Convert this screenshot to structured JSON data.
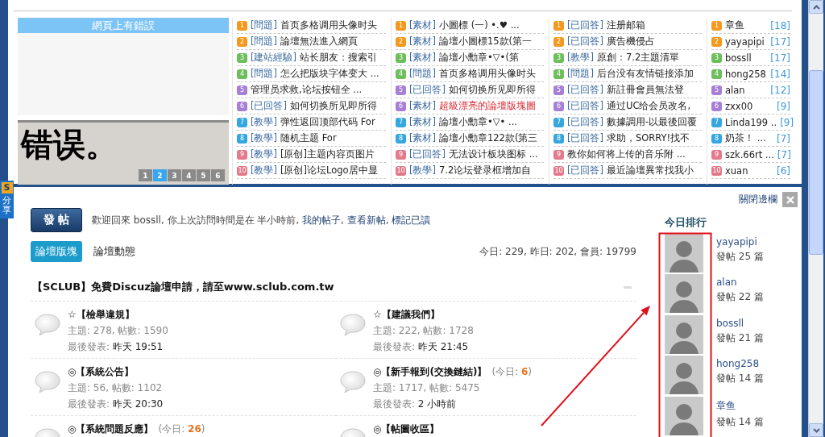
{
  "share": {
    "logo": "S",
    "label": "分享"
  },
  "hot": {
    "slideshow": {
      "title": "網頁上有錯誤",
      "caption": "错误。",
      "pages": [
        {
          "label": "1",
          "selected": false
        },
        {
          "label": "2",
          "selected": true
        },
        {
          "label": "3",
          "selected": false
        },
        {
          "label": "4",
          "selected": false
        },
        {
          "label": "5",
          "selected": false
        },
        {
          "label": "6",
          "selected": false
        }
      ]
    },
    "columns": [
      {
        "items": [
          {
            "rank": "1",
            "color": "#f39a1e",
            "tag": "[問題]",
            "title": "首页多格调用头像时头",
            "hot": false
          },
          {
            "rank": "2",
            "color": "#f39a1e",
            "tag": "[問題]",
            "title": "論壇無法進入網頁",
            "hot": false
          },
          {
            "rank": "3",
            "color": "#6cbf5a",
            "tag": "[建站經驗]",
            "title": "站长朋友：搜索引",
            "hot": false
          },
          {
            "rank": "4",
            "color": "#6cbf5a",
            "tag": "[問題]",
            "title": "怎么把版块字体变大 ...",
            "hot": false
          },
          {
            "rank": "5",
            "color": "#a67fd6",
            "title": "管理员求救,论坛按钮全 ...",
            "hot": false
          },
          {
            "rank": "6",
            "color": "#a67fd6",
            "tag": "[已回答]",
            "title": "如何切换所见即所得",
            "hot": false
          },
          {
            "rank": "7",
            "color": "#35a7de",
            "tag": "[教學]",
            "title": "弹性返回顶部代码 For",
            "hot": false
          },
          {
            "rank": "8",
            "color": "#35a7de",
            "tag": "[教學]",
            "title": "随机主题 For",
            "hot": false
          },
          {
            "rank": "9",
            "color": "#e37a8a",
            "tag": "[教學]",
            "title": "[原创]主题内容页图片",
            "hot": false
          },
          {
            "rank": "10",
            "color": "#e37a8a",
            "tag": "[教學]",
            "title": "[原创]论坛Logo居中显",
            "hot": false
          }
        ]
      },
      {
        "items": [
          {
            "rank": "1",
            "color": "#f39a1e",
            "tag": "[素材]",
            "title": "小圖標 (一) •.♥ ...",
            "hot": false
          },
          {
            "rank": "2",
            "color": "#f39a1e",
            "tag": "[素材]",
            "title": "論壇小圖標15款(第一",
            "hot": false
          },
          {
            "rank": "3",
            "color": "#6cbf5a",
            "tag": "[素材]",
            "title": "論壇小勳章•▽•(第",
            "hot": false
          },
          {
            "rank": "4",
            "color": "#6cbf5a",
            "tag": "[問題]",
            "title": "首页多格调用头像时头",
            "hot": false
          },
          {
            "rank": "5",
            "color": "#a67fd6",
            "tag": "[已回答]",
            "title": "如何切换所见即所得",
            "hot": false
          },
          {
            "rank": "6",
            "color": "#a67fd6",
            "tag": "[素材]",
            "title": "超級漂亮的論壇版塊圖",
            "hot": true
          },
          {
            "rank": "7",
            "color": "#35a7de",
            "tag": "[素材]",
            "title": "論壇小勳章•▽• ...",
            "hot": false
          },
          {
            "rank": "8",
            "color": "#35a7de",
            "tag": "[素材]",
            "title": "論壇小勳章122款(第三",
            "hot": false
          },
          {
            "rank": "9",
            "color": "#e37a8a",
            "tag": "[已回答]",
            "title": "无法设计板块图标 ...",
            "hot": false
          },
          {
            "rank": "10",
            "color": "#e37a8a",
            "tag": "[教學]",
            "title": "7.2论坛登录框增加自",
            "hot": false
          }
        ]
      },
      {
        "items": [
          {
            "rank": "1",
            "color": "#f39a1e",
            "tag": "[已回答]",
            "title": "注册邮箱",
            "hot": false
          },
          {
            "rank": "2",
            "color": "#f39a1e",
            "tag": "[已回答]",
            "title": "廣告機侵占",
            "hot": false
          },
          {
            "rank": "3",
            "color": "#6cbf5a",
            "tag": "[教學]",
            "title": "原創：7.2主題清單",
            "hot": false
          },
          {
            "rank": "4",
            "color": "#6cbf5a",
            "tag": "[問題]",
            "title": "后台没有友情链接添加",
            "hot": false
          },
          {
            "rank": "5",
            "color": "#a67fd6",
            "tag": "[已回答]",
            "title": "新註冊會員無法登",
            "hot": false
          },
          {
            "rank": "6",
            "color": "#a67fd6",
            "tag": "[已回答]",
            "title": "通过UC给会员改名,",
            "hot": false
          },
          {
            "rank": "7",
            "color": "#35a7de",
            "tag": "[已回答]",
            "title": "數據調用-以最後回覆",
            "hot": false
          },
          {
            "rank": "8",
            "color": "#35a7de",
            "tag": "[已回答]",
            "title": "求助，SORRY!找不",
            "hot": false
          },
          {
            "rank": "9",
            "color": "#e37a8a",
            "title": "教你如何将上传的音乐附 ...",
            "hot": false
          },
          {
            "rank": "10",
            "color": "#e37a8a",
            "tag": "[已回答]",
            "title": "最近論壇異常找我小",
            "hot": false
          }
        ]
      }
    ],
    "users": [
      {
        "rank": "1",
        "color": "#f39a1e",
        "name": "章鱼",
        "count": "[18]"
      },
      {
        "rank": "2",
        "color": "#f39a1e",
        "name": "yayapipi",
        "count": "[17]"
      },
      {
        "rank": "3",
        "color": "#6cbf5a",
        "name": "bossll",
        "count": "[17]"
      },
      {
        "rank": "4",
        "color": "#6cbf5a",
        "name": "hong258",
        "count": "[14]"
      },
      {
        "rank": "5",
        "color": "#a67fd6",
        "name": "alan",
        "count": "[12]"
      },
      {
        "rank": "6",
        "color": "#a67fd6",
        "name": "zxx00",
        "count": "[9]"
      },
      {
        "rank": "7",
        "color": "#35a7de",
        "name": "Linda199 ..",
        "count": "[9]"
      },
      {
        "rank": "8",
        "color": "#35a7de",
        "name": "奶茶！ ...",
        "count": "[7]"
      },
      {
        "rank": "9",
        "color": "#e37a8a",
        "name": "szk.66rt ...",
        "count": "[7]"
      },
      {
        "rank": "10",
        "color": "#e37a8a",
        "name": "xuan",
        "count": "[6]"
      }
    ]
  },
  "post_button": "發 帖",
  "welcome": [
    {
      "kind": "text",
      "text": "歡迎回來 bossll, 你上次訪問時間是在 半小時前, "
    },
    {
      "kind": "link",
      "text": "我的帖子"
    },
    {
      "kind": "text",
      "text": ", "
    },
    {
      "kind": "link",
      "text": "查看新帖"
    },
    {
      "kind": "text",
      "text": ", "
    },
    {
      "kind": "link",
      "text": "標記已讀"
    }
  ],
  "tabs": [
    {
      "label": "論壇版塊",
      "selected": true
    },
    {
      "label": "論壇動態",
      "selected": false
    }
  ],
  "stats": "今日: 229, 昨日: 202, 會員: 19799",
  "category": {
    "title": "【SCLUB】免費Discuz論壇申請，請至www.sclub.com.tw",
    "forums": [
      {
        "title": "☆【檢舉違規】",
        "topics": "主題: 278, 帖數: 1590",
        "last_label": "最後發表:",
        "last_value": "昨天 19:51"
      },
      {
        "title": "☆【建議我們】",
        "topics": "主題: 222, 帖數: 1728",
        "last_label": "最後發表:",
        "last_value": "昨天 21:45"
      },
      {
        "title": "◎【系統公告】",
        "topics": "主題: 56, 帖數: 1102",
        "last_label": "最後發表:",
        "last_value": "昨天 20:30"
      },
      {
        "title": "◎【新手報到(交換鏈結)】",
        "today": "(今日: **6**)",
        "topics": "主題: 1717, 帖數: 5475",
        "last_label": "最後發表:",
        "last_value": "2 小時前"
      },
      {
        "title": "◎【系統問題反應】",
        "today": "(今日: **26**)"
      },
      {
        "title": "◎【帖圖收區】"
      }
    ]
  },
  "sidebar": {
    "close_label": "關閉邊欄",
    "ranking_title": "今日排行",
    "users": [
      {
        "name": "yayapipi",
        "posts": "發帖 25 篇"
      },
      {
        "name": "alan",
        "posts": "發帖 22 篇"
      },
      {
        "name": "bossll",
        "posts": "發帖 21 篇"
      },
      {
        "name": "hong258",
        "posts": "發帖 14 篇"
      },
      {
        "name": "章鱼",
        "posts": "發帖 14 篇"
      }
    ]
  },
  "annotations": [
    {
      "kind": "box"
    },
    {
      "kind": "arrow"
    }
  ]
}
